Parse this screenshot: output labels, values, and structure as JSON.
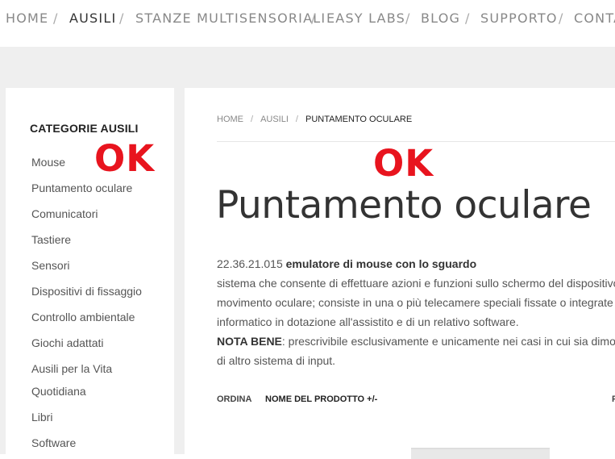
{
  "topnav": {
    "items": [
      {
        "label": "HOME",
        "active": false
      },
      {
        "label": "AUSILI",
        "active": true
      },
      {
        "label": "STANZE MULTISENSORIALI",
        "active": false
      },
      {
        "label": "EASY LABS",
        "active": false
      },
      {
        "label": "BLOG",
        "active": false
      },
      {
        "label": "SUPPORTO",
        "active": false
      },
      {
        "label": "CONTA",
        "active": false
      }
    ],
    "separator": "/"
  },
  "sidebar": {
    "title": "CATEGORIE AUSILI",
    "categories": [
      "Mouse",
      "Puntamento oculare",
      "Comunicatori",
      "Tastiere",
      "Sensori",
      "Dispositivi di fissaggio",
      "Controllo ambientale",
      "Giochi adattati",
      "Ausili per la Vita",
      "Quotidiana",
      "Libri",
      "Software"
    ]
  },
  "annotations": {
    "sidebar_ok": "OK",
    "content_ok": "OK",
    "color": "#e8141e"
  },
  "breadcrumb": {
    "items": [
      "HOME",
      "AUSILI",
      "PUNTAMENTO OCULARE"
    ],
    "separator": "/"
  },
  "page": {
    "title": "Puntamento oculare",
    "code": "22.36.21.015",
    "code_label": "emulatore di mouse con lo sguardo",
    "lines": [
      "sistema che consente di effettuare azioni e funzioni sullo schermo del dispositivo",
      "movimento oculare; consiste in una o più telecamere speciali fissate o integrate",
      "informatico in dotazione all'assistito e di un relativo software."
    ],
    "nota_label": "NOTA BENE",
    "nota_text": ": prescrivibile esclusivamente e unicamente nei casi in cui sia dimo",
    "last_line": "di altro sistema di input."
  },
  "sorting": {
    "label": "ORDINA",
    "value": "NOME DEL PRODOTTO +/-",
    "edge": "P"
  }
}
